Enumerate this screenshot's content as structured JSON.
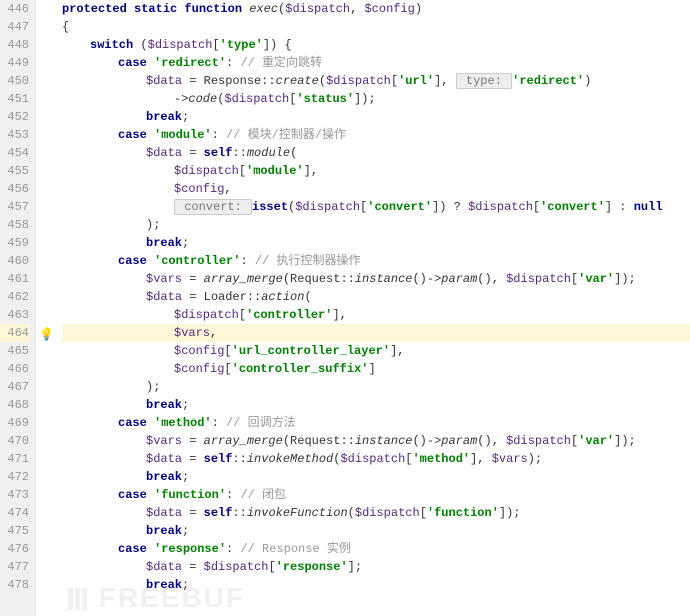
{
  "watermark": "FREEBUF",
  "bulb_line": 464,
  "highlight_line": 464,
  "lines": [
    {
      "n": 446,
      "ind": 1,
      "tokens": [
        {
          "t": "kw",
          "v": "protected static function "
        },
        {
          "t": "fn",
          "v": "exec"
        },
        {
          "t": "p",
          "v": "("
        },
        {
          "t": "var",
          "v": "$dispatch"
        },
        {
          "t": "p",
          "v": ", "
        },
        {
          "t": "var",
          "v": "$config"
        },
        {
          "t": "p",
          "v": ")"
        }
      ]
    },
    {
      "n": 447,
      "ind": 1,
      "tokens": [
        {
          "t": "p",
          "v": "{"
        }
      ]
    },
    {
      "n": 448,
      "ind": 2,
      "tokens": [
        {
          "t": "kw",
          "v": "switch "
        },
        {
          "t": "p",
          "v": "("
        },
        {
          "t": "var",
          "v": "$dispatch"
        },
        {
          "t": "p",
          "v": "["
        },
        {
          "t": "str",
          "v": "'type'"
        },
        {
          "t": "p",
          "v": "]) {"
        }
      ]
    },
    {
      "n": 449,
      "ind": 3,
      "tokens": [
        {
          "t": "kw",
          "v": "case "
        },
        {
          "t": "str",
          "v": "'redirect'"
        },
        {
          "t": "p",
          "v": ": "
        },
        {
          "t": "cm",
          "v": "// 重定向跳转"
        }
      ]
    },
    {
      "n": 450,
      "ind": 4,
      "tokens": [
        {
          "t": "var",
          "v": "$data"
        },
        {
          "t": "p",
          "v": " = Response::"
        },
        {
          "t": "fn",
          "v": "create"
        },
        {
          "t": "p",
          "v": "("
        },
        {
          "t": "var",
          "v": "$dispatch"
        },
        {
          "t": "p",
          "v": "["
        },
        {
          "t": "str",
          "v": "'url'"
        },
        {
          "t": "p",
          "v": "], "
        },
        {
          "t": "box",
          "v": " type: "
        },
        {
          "t": "str",
          "v": "'redirect'"
        },
        {
          "t": "p",
          "v": ")"
        }
      ]
    },
    {
      "n": 451,
      "ind": 5,
      "tokens": [
        {
          "t": "p",
          "v": "->"
        },
        {
          "t": "fn",
          "v": "code"
        },
        {
          "t": "p",
          "v": "("
        },
        {
          "t": "var",
          "v": "$dispatch"
        },
        {
          "t": "p",
          "v": "["
        },
        {
          "t": "str",
          "v": "'status'"
        },
        {
          "t": "p",
          "v": "]);"
        }
      ]
    },
    {
      "n": 452,
      "ind": 4,
      "tokens": [
        {
          "t": "kw",
          "v": "break"
        },
        {
          "t": "p",
          "v": ";"
        }
      ]
    },
    {
      "n": 453,
      "ind": 3,
      "tokens": [
        {
          "t": "kw",
          "v": "case "
        },
        {
          "t": "str",
          "v": "'module'"
        },
        {
          "t": "p",
          "v": ": "
        },
        {
          "t": "cm",
          "v": "// 模块/控制器/操作"
        }
      ]
    },
    {
      "n": 454,
      "ind": 4,
      "tokens": [
        {
          "t": "var",
          "v": "$data"
        },
        {
          "t": "p",
          "v": " = "
        },
        {
          "t": "kw",
          "v": "self"
        },
        {
          "t": "p",
          "v": "::"
        },
        {
          "t": "fn",
          "v": "module"
        },
        {
          "t": "p",
          "v": "("
        }
      ]
    },
    {
      "n": 455,
      "ind": 5,
      "tokens": [
        {
          "t": "var",
          "v": "$dispatch"
        },
        {
          "t": "p",
          "v": "["
        },
        {
          "t": "str",
          "v": "'module'"
        },
        {
          "t": "p",
          "v": "],"
        }
      ]
    },
    {
      "n": 456,
      "ind": 5,
      "tokens": [
        {
          "t": "var",
          "v": "$config"
        },
        {
          "t": "p",
          "v": ","
        }
      ]
    },
    {
      "n": 457,
      "ind": 5,
      "tokens": [
        {
          "t": "box",
          "v": " convert: "
        },
        {
          "t": "kw",
          "v": "isset"
        },
        {
          "t": "p",
          "v": "("
        },
        {
          "t": "var",
          "v": "$dispatch"
        },
        {
          "t": "p",
          "v": "["
        },
        {
          "t": "str",
          "v": "'convert'"
        },
        {
          "t": "p",
          "v": "]) ? "
        },
        {
          "t": "var",
          "v": "$dispatch"
        },
        {
          "t": "p",
          "v": "["
        },
        {
          "t": "str",
          "v": "'convert'"
        },
        {
          "t": "p",
          "v": "] : "
        },
        {
          "t": "kw",
          "v": "null"
        }
      ]
    },
    {
      "n": 458,
      "ind": 4,
      "tokens": [
        {
          "t": "p",
          "v": ");"
        }
      ]
    },
    {
      "n": 459,
      "ind": 4,
      "tokens": [
        {
          "t": "kw",
          "v": "break"
        },
        {
          "t": "p",
          "v": ";"
        }
      ]
    },
    {
      "n": 460,
      "ind": 3,
      "tokens": [
        {
          "t": "kw",
          "v": "case "
        },
        {
          "t": "str",
          "v": "'controller'"
        },
        {
          "t": "p",
          "v": ": "
        },
        {
          "t": "cm",
          "v": "// 执行控制器操作"
        }
      ]
    },
    {
      "n": 461,
      "ind": 4,
      "tokens": [
        {
          "t": "var",
          "v": "$vars"
        },
        {
          "t": "p",
          "v": " = "
        },
        {
          "t": "fn",
          "v": "array_merge"
        },
        {
          "t": "p",
          "v": "(Request::"
        },
        {
          "t": "fn",
          "v": "instance"
        },
        {
          "t": "p",
          "v": "()->"
        },
        {
          "t": "fn",
          "v": "param"
        },
        {
          "t": "p",
          "v": "(), "
        },
        {
          "t": "var",
          "v": "$dispatch"
        },
        {
          "t": "p",
          "v": "["
        },
        {
          "t": "str",
          "v": "'var'"
        },
        {
          "t": "p",
          "v": "]);"
        }
      ]
    },
    {
      "n": 462,
      "ind": 4,
      "tokens": [
        {
          "t": "var",
          "v": "$data"
        },
        {
          "t": "p",
          "v": " = Loader::"
        },
        {
          "t": "fn",
          "v": "action"
        },
        {
          "t": "p",
          "v": "("
        }
      ]
    },
    {
      "n": 463,
      "ind": 5,
      "tokens": [
        {
          "t": "var",
          "v": "$dispatch"
        },
        {
          "t": "p",
          "v": "["
        },
        {
          "t": "str",
          "v": "'controller'"
        },
        {
          "t": "p",
          "v": "],"
        }
      ]
    },
    {
      "n": 464,
      "ind": 5,
      "tokens": [
        {
          "t": "var",
          "v": "$vars"
        },
        {
          "t": "p",
          "v": ","
        }
      ]
    },
    {
      "n": 465,
      "ind": 5,
      "tokens": [
        {
          "t": "var",
          "v": "$config"
        },
        {
          "t": "p",
          "v": "["
        },
        {
          "t": "str",
          "v": "'url_controller_layer'"
        },
        {
          "t": "p",
          "v": "],"
        }
      ]
    },
    {
      "n": 466,
      "ind": 5,
      "tokens": [
        {
          "t": "var",
          "v": "$config"
        },
        {
          "t": "p",
          "v": "["
        },
        {
          "t": "str",
          "v": "'controller_suffix'"
        },
        {
          "t": "p",
          "v": "]"
        }
      ]
    },
    {
      "n": 467,
      "ind": 4,
      "tokens": [
        {
          "t": "p",
          "v": ");"
        }
      ]
    },
    {
      "n": 468,
      "ind": 4,
      "tokens": [
        {
          "t": "kw",
          "v": "break"
        },
        {
          "t": "p",
          "v": ";"
        }
      ]
    },
    {
      "n": 469,
      "ind": 3,
      "tokens": [
        {
          "t": "kw",
          "v": "case "
        },
        {
          "t": "str",
          "v": "'method'"
        },
        {
          "t": "p",
          "v": ": "
        },
        {
          "t": "cm",
          "v": "// 回调方法"
        }
      ]
    },
    {
      "n": 470,
      "ind": 4,
      "tokens": [
        {
          "t": "var",
          "v": "$vars"
        },
        {
          "t": "p",
          "v": " = "
        },
        {
          "t": "fn",
          "v": "array_merge"
        },
        {
          "t": "p",
          "v": "(Request::"
        },
        {
          "t": "fn",
          "v": "instance"
        },
        {
          "t": "p",
          "v": "()->"
        },
        {
          "t": "fn",
          "v": "param"
        },
        {
          "t": "p",
          "v": "(), "
        },
        {
          "t": "var",
          "v": "$dispatch"
        },
        {
          "t": "p",
          "v": "["
        },
        {
          "t": "str",
          "v": "'var'"
        },
        {
          "t": "p",
          "v": "]);"
        }
      ]
    },
    {
      "n": 471,
      "ind": 4,
      "tokens": [
        {
          "t": "var",
          "v": "$data"
        },
        {
          "t": "p",
          "v": " = "
        },
        {
          "t": "kw",
          "v": "self"
        },
        {
          "t": "p",
          "v": "::"
        },
        {
          "t": "fn",
          "v": "invokeMethod"
        },
        {
          "t": "p",
          "v": "("
        },
        {
          "t": "var",
          "v": "$dispatch"
        },
        {
          "t": "p",
          "v": "["
        },
        {
          "t": "str",
          "v": "'method'"
        },
        {
          "t": "p",
          "v": "], "
        },
        {
          "t": "var",
          "v": "$vars"
        },
        {
          "t": "p",
          "v": ");"
        }
      ]
    },
    {
      "n": 472,
      "ind": 4,
      "tokens": [
        {
          "t": "kw",
          "v": "break"
        },
        {
          "t": "p",
          "v": ";"
        }
      ]
    },
    {
      "n": 473,
      "ind": 3,
      "tokens": [
        {
          "t": "kw",
          "v": "case "
        },
        {
          "t": "str",
          "v": "'function'"
        },
        {
          "t": "p",
          "v": ": "
        },
        {
          "t": "cm",
          "v": "// 闭包"
        }
      ]
    },
    {
      "n": 474,
      "ind": 4,
      "tokens": [
        {
          "t": "var",
          "v": "$data"
        },
        {
          "t": "p",
          "v": " = "
        },
        {
          "t": "kw",
          "v": "self"
        },
        {
          "t": "p",
          "v": "::"
        },
        {
          "t": "fn",
          "v": "invokeFunction"
        },
        {
          "t": "p",
          "v": "("
        },
        {
          "t": "var",
          "v": "$dispatch"
        },
        {
          "t": "p",
          "v": "["
        },
        {
          "t": "str",
          "v": "'function'"
        },
        {
          "t": "p",
          "v": "]);"
        }
      ]
    },
    {
      "n": 475,
      "ind": 4,
      "tokens": [
        {
          "t": "kw",
          "v": "break"
        },
        {
          "t": "p",
          "v": ";"
        }
      ]
    },
    {
      "n": 476,
      "ind": 3,
      "tokens": [
        {
          "t": "kw",
          "v": "case "
        },
        {
          "t": "str",
          "v": "'response'"
        },
        {
          "t": "p",
          "v": ": "
        },
        {
          "t": "cm",
          "v": "// Response 实例"
        }
      ]
    },
    {
      "n": 477,
      "ind": 4,
      "tokens": [
        {
          "t": "var",
          "v": "$data"
        },
        {
          "t": "p",
          "v": " = "
        },
        {
          "t": "var",
          "v": "$dispatch"
        },
        {
          "t": "p",
          "v": "["
        },
        {
          "t": "str",
          "v": "'response'"
        },
        {
          "t": "p",
          "v": "];"
        }
      ]
    },
    {
      "n": 478,
      "ind": 4,
      "tokens": [
        {
          "t": "kw",
          "v": "break"
        },
        {
          "t": "p",
          "v": ";"
        }
      ]
    }
  ]
}
